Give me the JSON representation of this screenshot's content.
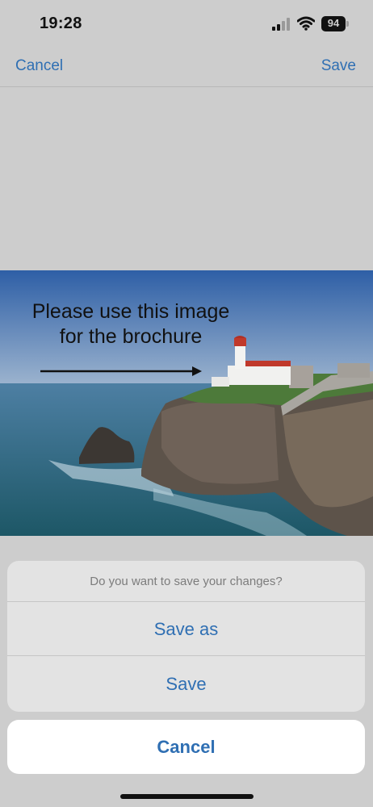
{
  "status_bar": {
    "time": "19:28",
    "battery_level": "94"
  },
  "nav": {
    "cancel_label": "Cancel",
    "save_label": "Save"
  },
  "image": {
    "annotation_line1": "Please use this image",
    "annotation_line2": "for the brochure"
  },
  "action_sheet": {
    "title": "Do you want to save your changes?",
    "save_as_label": "Save as",
    "save_label": "Save",
    "cancel_label": "Cancel"
  },
  "colors": {
    "accent": "#2f6fb3",
    "background": "#cdcdcd",
    "sheet": "#e3e3e3"
  }
}
